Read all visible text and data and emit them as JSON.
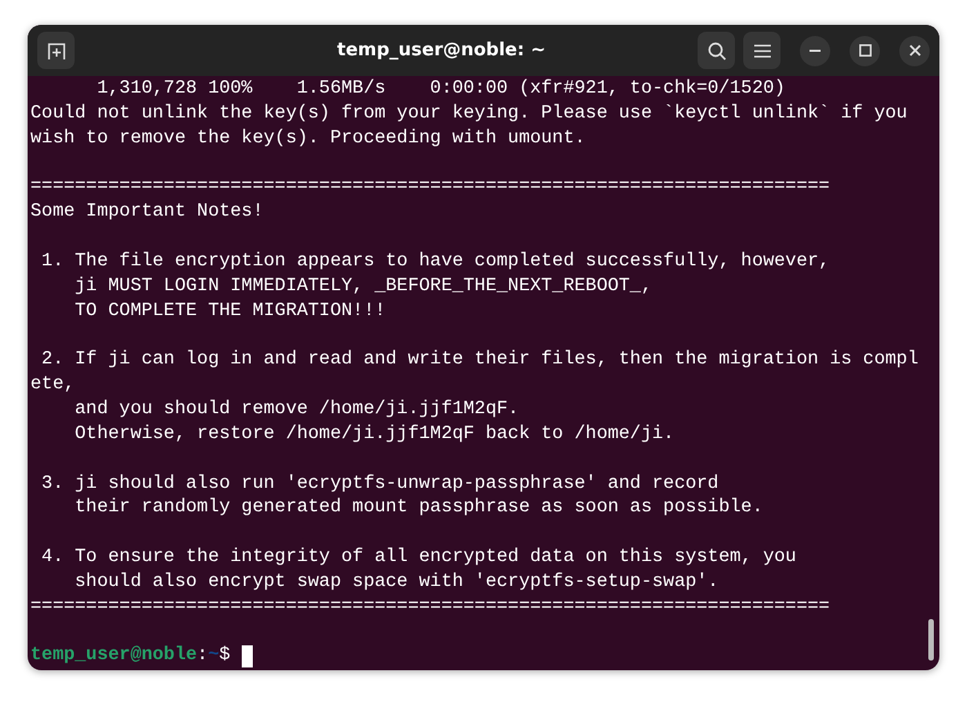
{
  "window": {
    "title": "temp_user@noble: ~"
  },
  "terminal": {
    "lines": [
      {
        "kind": "output",
        "text": "      1,310,728 100%    1.56MB/s    0:00:00 (xfr#921, to-chk=0/1520)"
      },
      {
        "kind": "output",
        "text": "Could not unlink the key(s) from your keying. Please use `keyctl unlink` if you"
      },
      {
        "kind": "output",
        "text": "wish to remove the key(s). Proceeding with umount."
      },
      {
        "kind": "blank"
      },
      {
        "kind": "output",
        "text": "========================================================================"
      },
      {
        "kind": "output",
        "text": "Some Important Notes!"
      },
      {
        "kind": "blank"
      },
      {
        "kind": "output",
        "text": " 1. The file encryption appears to have completed successfully, however,"
      },
      {
        "kind": "output",
        "text": "    ji MUST LOGIN IMMEDIATELY, _BEFORE_THE_NEXT_REBOOT_,"
      },
      {
        "kind": "output",
        "text": "    TO COMPLETE THE MIGRATION!!!"
      },
      {
        "kind": "blank"
      },
      {
        "kind": "output",
        "text": " 2. If ji can log in and read and write their files, then the migration is compl"
      },
      {
        "kind": "output",
        "text": "ete,"
      },
      {
        "kind": "output",
        "text": "    and you should remove /home/ji.jjf1M2qF."
      },
      {
        "kind": "output",
        "text": "    Otherwise, restore /home/ji.jjf1M2qF back to /home/ji."
      },
      {
        "kind": "blank"
      },
      {
        "kind": "output",
        "text": " 3. ji should also run 'ecryptfs-unwrap-passphrase' and record"
      },
      {
        "kind": "output",
        "text": "    their randomly generated mount passphrase as soon as possible."
      },
      {
        "kind": "blank"
      },
      {
        "kind": "output",
        "text": " 4. To ensure the integrity of all encrypted data on this system, you"
      },
      {
        "kind": "output",
        "text": "    should also encrypt swap space with 'ecryptfs-setup-swap'."
      },
      {
        "kind": "output",
        "text": "========================================================================"
      },
      {
        "kind": "blank"
      }
    ],
    "prompt": {
      "user_host": "temp_user@noble",
      "separator": ":",
      "path": "~",
      "symbol": "$"
    }
  }
}
